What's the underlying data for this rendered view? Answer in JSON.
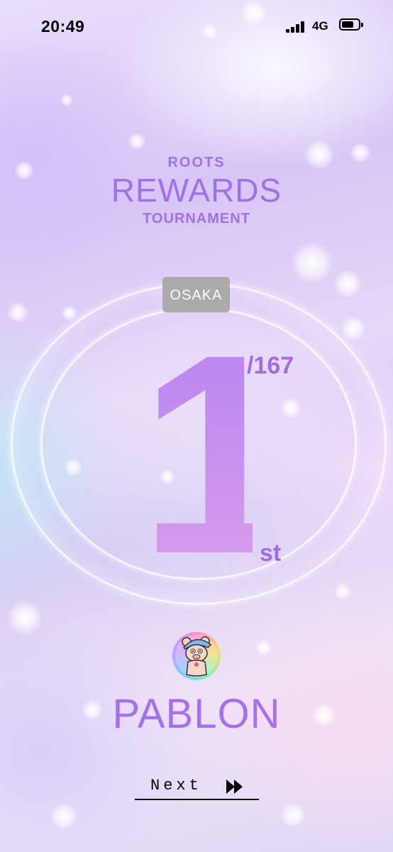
{
  "status_bar": {
    "time": "20:49",
    "network": "4G"
  },
  "header": {
    "line1": "ROOTS",
    "line2": "REWARDS",
    "line3": "TOURNAMENT"
  },
  "result": {
    "city": "OSAKA",
    "rank": "1",
    "rank_total": "/167",
    "rank_suffix": "st"
  },
  "player": {
    "name": "PABLON",
    "avatar_icon": "pig-character-avatar"
  },
  "footer": {
    "next_label": "Next",
    "next_icon": "fast-forward-icon"
  },
  "colors": {
    "accent": "#a56ff0",
    "badge": "#a8a8a8"
  }
}
